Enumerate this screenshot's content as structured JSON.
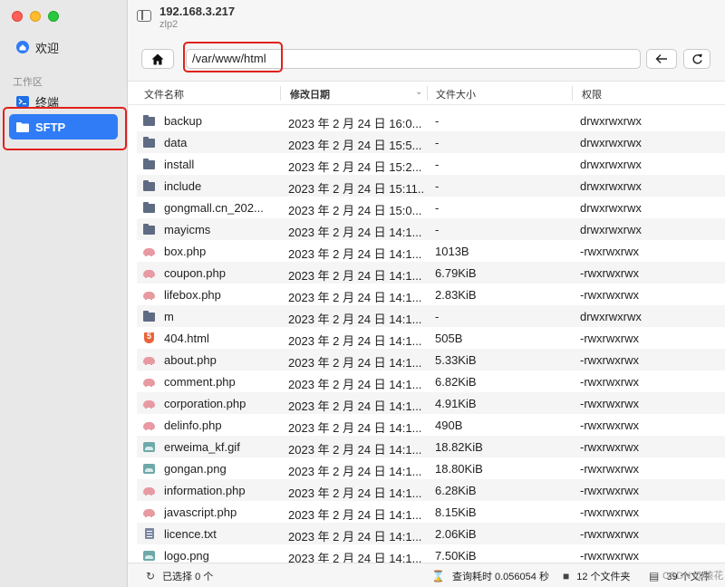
{
  "sidebar": {
    "welcome_label": "欢迎",
    "section_label": "工作区",
    "terminal_label": "终端",
    "sftp_label": "SFTP"
  },
  "titlebar": {
    "host": "192.168.3.217",
    "user": "zlp2"
  },
  "toolbar": {
    "path_value": "/var/www/html"
  },
  "columns": {
    "name": "文件名称",
    "date": "修改日期",
    "size": "文件大小",
    "perm": "权限"
  },
  "files": [
    {
      "icon": "folder-icon",
      "name": "backup",
      "date": "2023 年 2 月 24 日 16:0...",
      "size": "-",
      "perm": "drwxrwxrwx"
    },
    {
      "icon": "folder-icon",
      "name": "data",
      "date": "2023 年 2 月 24 日 15:5...",
      "size": "-",
      "perm": "drwxrwxrwx"
    },
    {
      "icon": "folder-icon",
      "name": "install",
      "date": "2023 年 2 月 24 日 15:2...",
      "size": "-",
      "perm": "drwxrwxrwx"
    },
    {
      "icon": "folder-icon",
      "name": "include",
      "date": "2023 年 2 月 24 日 15:11...",
      "size": "-",
      "perm": "drwxrwxrwx"
    },
    {
      "icon": "folder-icon",
      "name": "gongmall.cn_202...",
      "date": "2023 年 2 月 24 日 15:0...",
      "size": "-",
      "perm": "drwxrwxrwx"
    },
    {
      "icon": "folder-icon",
      "name": "mayicms",
      "date": "2023 年 2 月 24 日 14:1...",
      "size": "-",
      "perm": "drwxrwxrwx"
    },
    {
      "icon": "php-icon",
      "name": "box.php",
      "date": "2023 年 2 月 24 日 14:1...",
      "size": "1013B",
      "perm": "-rwxrwxrwx"
    },
    {
      "icon": "php-icon",
      "name": "coupon.php",
      "date": "2023 年 2 月 24 日 14:1...",
      "size": "6.79KiB",
      "perm": "-rwxrwxrwx"
    },
    {
      "icon": "php-icon",
      "name": "lifebox.php",
      "date": "2023 年 2 月 24 日 14:1...",
      "size": "2.83KiB",
      "perm": "-rwxrwxrwx"
    },
    {
      "icon": "folder-icon",
      "name": "m",
      "date": "2023 年 2 月 24 日 14:1...",
      "size": "-",
      "perm": "drwxrwxrwx"
    },
    {
      "icon": "html-icon",
      "name": "404.html",
      "date": "2023 年 2 月 24 日 14:1...",
      "size": "505B",
      "perm": "-rwxrwxrwx"
    },
    {
      "icon": "php-icon",
      "name": "about.php",
      "date": "2023 年 2 月 24 日 14:1...",
      "size": "5.33KiB",
      "perm": "-rwxrwxrwx"
    },
    {
      "icon": "php-icon",
      "name": "comment.php",
      "date": "2023 年 2 月 24 日 14:1...",
      "size": "6.82KiB",
      "perm": "-rwxrwxrwx"
    },
    {
      "icon": "php-icon",
      "name": "corporation.php",
      "date": "2023 年 2 月 24 日 14:1...",
      "size": "4.91KiB",
      "perm": "-rwxrwxrwx"
    },
    {
      "icon": "php-icon",
      "name": "delinfo.php",
      "date": "2023 年 2 月 24 日 14:1...",
      "size": "490B",
      "perm": "-rwxrwxrwx"
    },
    {
      "icon": "image-icon",
      "name": "erweima_kf.gif",
      "date": "2023 年 2 月 24 日 14:1...",
      "size": "18.82KiB",
      "perm": "-rwxrwxrwx"
    },
    {
      "icon": "image-icon",
      "name": "gongan.png",
      "date": "2023 年 2 月 24 日 14:1...",
      "size": "18.80KiB",
      "perm": "-rwxrwxrwx"
    },
    {
      "icon": "php-icon",
      "name": "information.php",
      "date": "2023 年 2 月 24 日 14:1...",
      "size": "6.28KiB",
      "perm": "-rwxrwxrwx"
    },
    {
      "icon": "php-icon",
      "name": "javascript.php",
      "date": "2023 年 2 月 24 日 14:1...",
      "size": "8.15KiB",
      "perm": "-rwxrwxrwx"
    },
    {
      "icon": "text-icon",
      "name": "licence.txt",
      "date": "2023 年 2 月 24 日 14:1...",
      "size": "2.06KiB",
      "perm": "-rwxrwxrwx"
    },
    {
      "icon": "image-icon",
      "name": "logo.png",
      "date": "2023 年 2 月 24 日 14:1...",
      "size": "7.50KiB",
      "perm": "-rwxrwxrwx"
    }
  ],
  "status": {
    "selected": "已选择 0 个",
    "query_time": "查询耗时 0.056054 秒",
    "folders": "12 个文件夹",
    "files": "39 个文件"
  },
  "watermark": "CSDN @猿花"
}
